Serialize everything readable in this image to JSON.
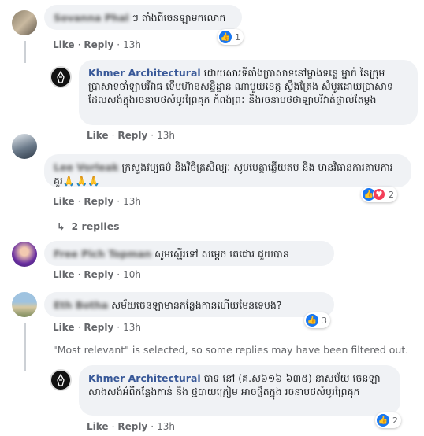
{
  "comments": [
    {
      "author_blurred": "Sovanna Phal",
      "text": "ៗ តាំងពីចេនឡាមកលោក",
      "reactions": "1"
    },
    {
      "author": "Khmer Architectural",
      "text": "ដោយសារទីតាំងប្រាសាទនៅម្ខាងទន្លេ ម្នាក់ នៃក្រុមប្រាសាទចាំឡាបរីវាធ ទើបហ៊ានសន្និដ្ឋាន ណាមួយខេត្ត ស្ទឹងត្រែង សំបូរដោយប្រាសាទដែលសង់ក្នុងរចនាបថសំបូរព្រៃគុក កំពង់ព្រះ និងរចនាបថថាឡាបរីវាត់ផ្ទាល់តែម្តង"
    },
    {
      "author_blurred": "Lee Vorleak",
      "text": "ក្រសួងវប្បធម៌ និងវិចិត្រសិល្បៈ សូមមេត្តាឆ្លើយតប និង មានវិធានការតាមការគួរ🙏🙏🙏",
      "reactions": "2"
    },
    {
      "author_blurred": "Free Pich Topman",
      "text": "សូមស្មើរទៅ សម្តេច តេជោរ ជួយបាន"
    },
    {
      "author_blurred": "Eth Botha",
      "text": "សម័យចេនឡាមានកន្លែងកាន់ហើយមែនទេបង?",
      "reactions": "3"
    },
    {
      "author": "Khmer Architectural",
      "text": "បាទ នៅ (គ.ស៦១៦-៦៣៥) នាសម័យ ចេនឡា សាងសង់អំពីកន្លែងកាន់ និង ថ្មបាយក្រៀម អាចផ្លិតក្នុង រចនាបថសំបូរព្រៃគុក",
      "reactions": "2"
    }
  ],
  "labels": {
    "like": "Like",
    "reply": "Reply",
    "dot": "·"
  },
  "times": [
    "13h",
    "13h",
    "13h",
    "10h",
    "13h",
    "13h"
  ],
  "replies_link": "2 replies",
  "notice": "\"Most relevant\" is selected, so some replies may have been filtered out.",
  "colors": {
    "link": "#385898",
    "bubble": "#f0f2f5",
    "like": "#1877f2",
    "love": "#f33e58"
  }
}
